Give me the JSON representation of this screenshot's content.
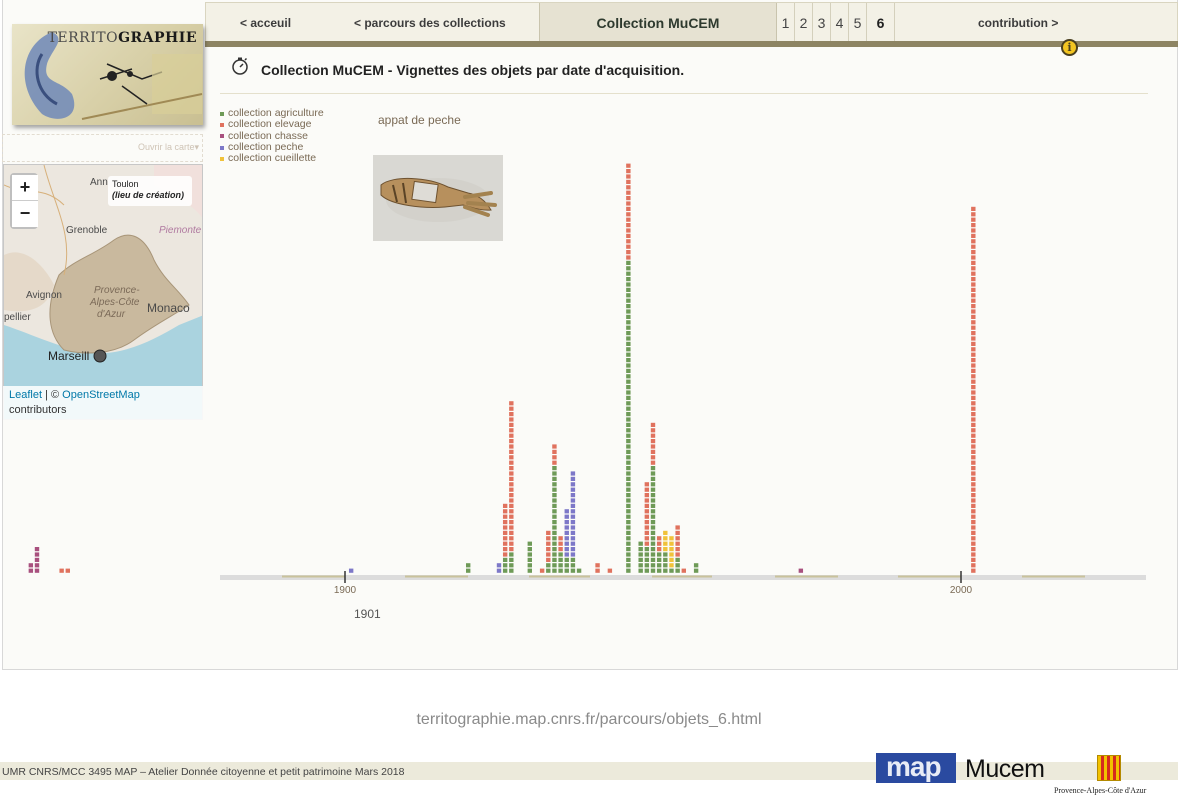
{
  "nav": {
    "home": "< acceuil",
    "parcours": "< parcours des collections",
    "current": "Collection MuCEM",
    "pages": [
      "1",
      "2",
      "3",
      "4",
      "5",
      "6"
    ],
    "active_page": "6",
    "contribution": "contribution >"
  },
  "logo": {
    "text_light": "TERRITO",
    "text_bold": "GRAPHIE"
  },
  "map": {
    "open_map": "Ouvrir la carte▾",
    "zoom_in": "+",
    "zoom_out": "−",
    "popup_place": "Toulon",
    "popup_sub": "(lieu de création)",
    "labels": {
      "grenoble": "Grenoble",
      "piemonte": "Piemonte",
      "avignon": "Avignon",
      "provence": "Provence-",
      "alpes": "Alpes-Côte",
      "azur": "d'Azur",
      "monaco": "Monaco",
      "marseille": "Marseill",
      "ann": "Ann",
      "pellier": "pellier"
    },
    "attribution_leaflet": "Leaflet",
    "attribution_sep": " | © ",
    "attribution_osm": "OpenStreetMap",
    "attribution_contrib": "contributors"
  },
  "content": {
    "title": "Collection MuCEM - Vignettes des objets par date d'acquisition.",
    "hovered_object": "appat de peche",
    "hovered_year": "1901"
  },
  "chart_data": {
    "type": "bar",
    "encoding": "stacked squares, one per object",
    "xlim": [
      1840,
      2030
    ],
    "x_ticks": [
      {
        "value": 1900,
        "label": "1900"
      },
      {
        "value": 2000,
        "label": "2000"
      }
    ],
    "legend": [
      {
        "name": "collection agriculture",
        "color": "#6e9a57"
      },
      {
        "name": "collection elevage",
        "color": "#e0725e"
      },
      {
        "name": "collection chasse",
        "color": "#a8507e"
      },
      {
        "name": "collection peche",
        "color": "#7d78c8"
      },
      {
        "name": "collection cueillette",
        "color": "#f0c23a"
      }
    ],
    "columns": [
      {
        "year": 1849,
        "counts": {
          "chasse": 2
        }
      },
      {
        "year": 1850,
        "counts": {
          "chasse": 5
        }
      },
      {
        "year": 1854,
        "counts": {
          "elevage": 1
        }
      },
      {
        "year": 1855,
        "counts": {
          "elevage": 1
        }
      },
      {
        "year": 1901,
        "counts": {
          "peche": 1
        }
      },
      {
        "year": 1920,
        "counts": {
          "agriculture": 2
        }
      },
      {
        "year": 1925,
        "counts": {
          "peche": 2
        }
      },
      {
        "year": 1926,
        "counts": {
          "agriculture": 3,
          "elevage": 10
        }
      },
      {
        "year": 1927,
        "counts": {
          "agriculture": 4,
          "elevage": 28
        }
      },
      {
        "year": 1930,
        "counts": {
          "agriculture": 6
        }
      },
      {
        "year": 1932,
        "counts": {
          "elevage": 1
        }
      },
      {
        "year": 1933,
        "counts": {
          "agriculture": 2,
          "elevage": 6
        }
      },
      {
        "year": 1934,
        "counts": {
          "agriculture": 20,
          "elevage": 4,
          "peche": 0,
          "chasse": 0,
          "cueillette": 0
        }
      },
      {
        "year": 1935,
        "counts": {
          "agriculture": 4,
          "elevage": 3
        }
      },
      {
        "year": 1936,
        "counts": {
          "agriculture": 3,
          "peche": 9
        }
      },
      {
        "year": 1937,
        "counts": {
          "agriculture": 3,
          "peche": 16
        }
      },
      {
        "year": 1938,
        "counts": {
          "agriculture": 1
        }
      },
      {
        "year": 1941,
        "counts": {
          "elevage": 2
        }
      },
      {
        "year": 1943,
        "counts": {
          "elevage": 1
        }
      },
      {
        "year": 1946,
        "counts": {
          "agriculture": 58,
          "elevage": 18
        }
      },
      {
        "year": 1948,
        "counts": {
          "agriculture": 6
        }
      },
      {
        "year": 1949,
        "counts": {
          "agriculture": 5,
          "elevage": 12
        }
      },
      {
        "year": 1950,
        "counts": {
          "agriculture": 20,
          "elevage": 8
        }
      },
      {
        "year": 1951,
        "counts": {
          "agriculture": 4,
          "elevage": 3
        }
      },
      {
        "year": 1952,
        "counts": {
          "agriculture": 4,
          "cueillette": 4,
          "elevage": 0
        }
      },
      {
        "year": 1953,
        "counts": {
          "agriculture": 1,
          "cueillette": 6
        }
      },
      {
        "year": 1954,
        "counts": {
          "agriculture": 3,
          "elevage": 6
        }
      },
      {
        "year": 1955,
        "counts": {
          "elevage": 1
        }
      },
      {
        "year": 1957,
        "counts": {
          "agriculture": 2
        }
      },
      {
        "year": 1974,
        "counts": {
          "chasse": 1
        }
      },
      {
        "year": 2002,
        "counts": {
          "elevage": 68
        }
      }
    ]
  },
  "footer": {
    "url": "territographie.map.cnrs.fr/parcours/objets_6.html",
    "credits": "UMR CNRS/MCC 3495 MAP –  Atelier Donnée citoyenne et petit patrimoine Mars 2018",
    "logo_map": "map",
    "logo_mucem": "Mucem",
    "logo_region": "Provence-Alpes-Côte d'Azur"
  }
}
